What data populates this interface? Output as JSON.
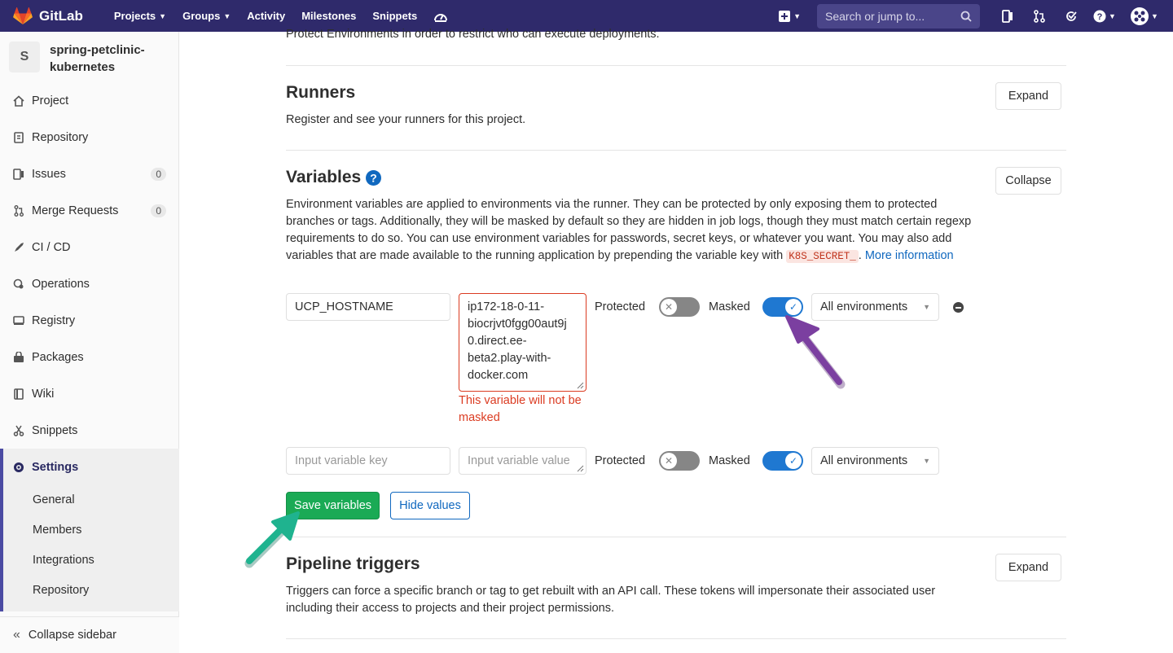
{
  "topbar": {
    "brand": "GitLab",
    "nav": [
      "Projects",
      "Groups",
      "Activity",
      "Milestones",
      "Snippets"
    ],
    "search_placeholder": "Search or jump to..."
  },
  "sidebar": {
    "avatar_letter": "S",
    "project_name": "spring-petclinic-kubernetes",
    "items": [
      {
        "label": "Project",
        "icon": "home-icon"
      },
      {
        "label": "Repository",
        "icon": "doc-icon"
      },
      {
        "label": "Issues",
        "icon": "issues-icon",
        "badge": "0"
      },
      {
        "label": "Merge Requests",
        "icon": "merge-icon",
        "badge": "0"
      },
      {
        "label": "CI / CD",
        "icon": "rocket-icon"
      },
      {
        "label": "Operations",
        "icon": "cloud-gear-icon"
      },
      {
        "label": "Registry",
        "icon": "disk-icon"
      },
      {
        "label": "Packages",
        "icon": "package-icon"
      },
      {
        "label": "Wiki",
        "icon": "book-icon"
      },
      {
        "label": "Snippets",
        "icon": "scissors-icon"
      },
      {
        "label": "Settings",
        "icon": "gear-icon"
      }
    ],
    "settings_sub": [
      "General",
      "Members",
      "Integrations",
      "Repository"
    ],
    "collapse_label": "Collapse sidebar"
  },
  "main": {
    "top_text": "Protect Environments in order to restrict who can execute deployments.",
    "runners": {
      "title": "Runners",
      "desc": "Register and see your runners for this project.",
      "button": "Expand"
    },
    "variables": {
      "title": "Variables",
      "button": "Collapse",
      "desc_part1": "Environment variables are applied to environments via the runner. They can be protected by only exposing them to protected branches or tags. Additionally, they will be masked by default so they are hidden in job logs, though they must match certain regexp requirements to do so. You can use environment variables for passwords, secret keys, or whatever you want. You may also add variables that are made available to the running application by prepending the variable key with",
      "code": "K8S_SECRET_",
      "more_info": "More information",
      "row1": {
        "key": "UCP_HOSTNAME",
        "value_lines": [
          "ip172-18-0-11-",
          "biocrjvt0fgg00aut9j",
          "0.direct.ee-",
          "beta2.play-with-",
          "docker.com"
        ],
        "protected_label": "Protected",
        "masked_label": "Masked",
        "environment": "All environments",
        "error": "This variable will not be masked"
      },
      "row2": {
        "key_placeholder": "Input variable key",
        "value_placeholder": "Input variable value",
        "protected_label": "Protected",
        "masked_label": "Masked",
        "environment": "All environments"
      },
      "save_button": "Save variables",
      "hide_button": "Hide values"
    },
    "pipeline": {
      "title": "Pipeline triggers",
      "desc": "Triggers can force a specific branch or tag to get rebuilt with an API call. These tokens will impersonate their associated user including their access to projects and their project permissions.",
      "button": "Expand"
    }
  },
  "colors": {
    "topbar": "#2f2a6b",
    "save": "#1aaa55",
    "toggle_on": "#1f78d1",
    "arrow_purple": "#7b3fa0",
    "arrow_teal": "#1fb38f"
  }
}
